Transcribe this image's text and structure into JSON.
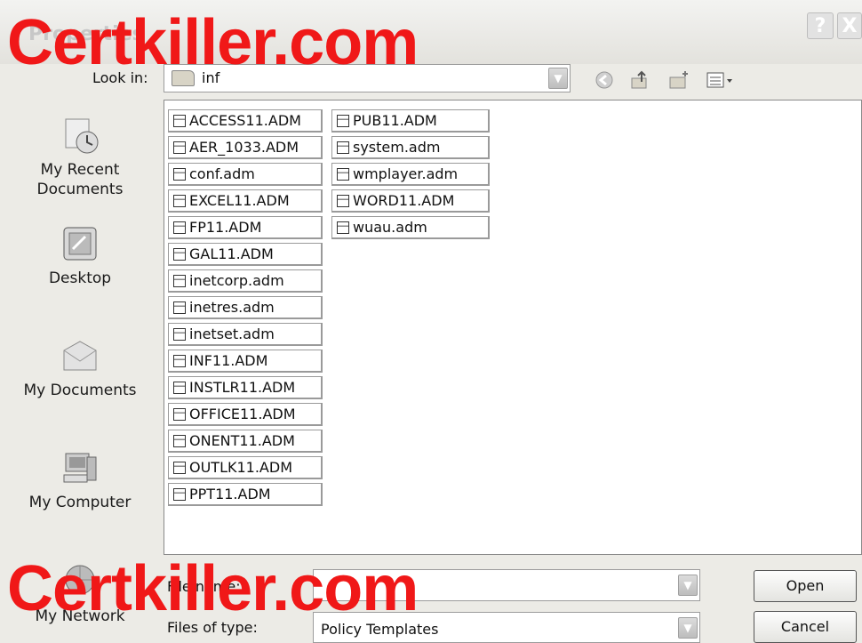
{
  "window": {
    "title": "Properties",
    "help_label": "?",
    "close_label": "X"
  },
  "lookin": {
    "label": "Look in:",
    "value": "inf"
  },
  "toolbar": {
    "back_icon": "back-icon",
    "up_icon": "up-folder-icon",
    "new_folder_icon": "new-folder-icon",
    "views_icon": "views-menu-icon"
  },
  "places": [
    {
      "label": "My Recent Documents",
      "icon": "recent-documents-icon"
    },
    {
      "label": "Desktop",
      "icon": "desktop-icon"
    },
    {
      "label": "My Documents",
      "icon": "my-documents-icon"
    },
    {
      "label": "My Computer",
      "icon": "my-computer-icon"
    },
    {
      "label": "My Network",
      "icon": "my-network-icon"
    }
  ],
  "files": {
    "column1": [
      "ACCESS11.ADM",
      "AER_1033.ADM",
      "conf.adm",
      "EXCEL11.ADM",
      "FP11.ADM",
      "GAL11.ADM",
      "inetcorp.adm",
      "inetres.adm",
      "inetset.adm",
      "INF11.ADM",
      "INSTLR11.ADM",
      "OFFICE11.ADM",
      "ONENT11.ADM",
      "OUTLK11.ADM",
      "PPT11.ADM"
    ],
    "column2": [
      "PUB11.ADM",
      "system.adm",
      "wmplayer.adm",
      "WORD11.ADM",
      "wuau.adm"
    ]
  },
  "bottom": {
    "filename_label": "File name:",
    "filename_value": "",
    "filetype_label": "Files of type:",
    "filetype_value": "Policy Templates",
    "open_label": "Open",
    "cancel_label": "Cancel"
  },
  "watermark": {
    "text_top": "Certkiller.com",
    "text_bottom": "Certkiller.com"
  },
  "colors": {
    "watermark": "#f01818",
    "dialog_bg": "#ecebe6"
  }
}
